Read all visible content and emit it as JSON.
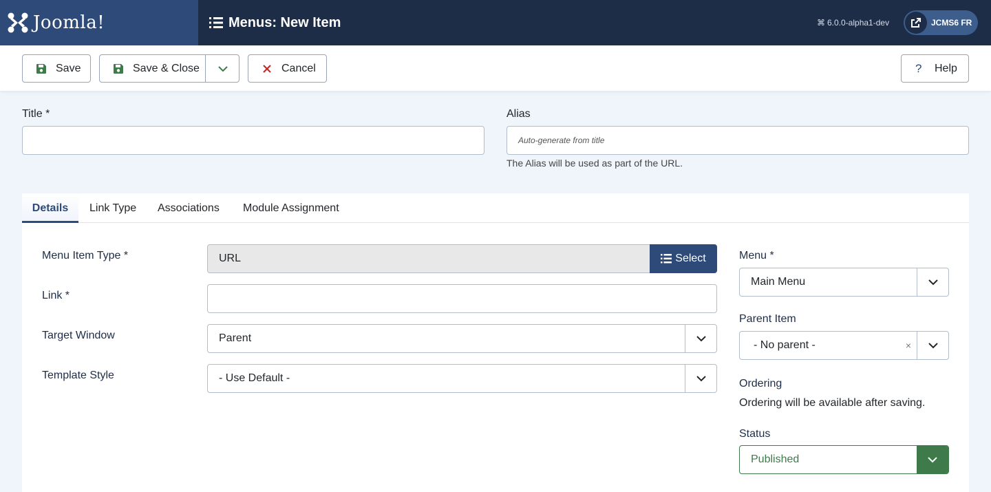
{
  "header": {
    "logo_text": "Joomla!",
    "page_title": "Menus: New Item",
    "version": "6.0.0-alpha1-dev",
    "site_button": "JCMS6 FR"
  },
  "toolbar": {
    "save": "Save",
    "save_close": "Save & Close",
    "cancel": "Cancel",
    "help": "Help"
  },
  "form": {
    "title_label": "Title *",
    "title_value": "",
    "alias_label": "Alias",
    "alias_placeholder": "Auto-generate from title",
    "alias_help": "The Alias will be used as part of the URL."
  },
  "tabs": [
    "Details",
    "Link Type",
    "Associations",
    "Module Assignment"
  ],
  "details": {
    "menu_item_type_label": "Menu Item Type *",
    "menu_item_type_value": "URL",
    "select_button": "Select",
    "link_label": "Link *",
    "link_value": "",
    "target_window_label": "Target Window",
    "target_window_value": "Parent",
    "template_style_label": "Template Style",
    "template_style_value": "- Use Default -"
  },
  "sidebar": {
    "menu_label": "Menu *",
    "menu_value": "Main Menu",
    "parent_label": "Parent Item",
    "parent_value": "- No parent -",
    "ordering_label": "Ordering",
    "ordering_text": "Ordering will be available after saving.",
    "status_label": "Status",
    "status_value": "Published"
  },
  "colors": {
    "header_bg": "#1d2c47",
    "brand": "#2d4a78",
    "published": "#3e7a4a",
    "cancel_x": "#c52827"
  }
}
